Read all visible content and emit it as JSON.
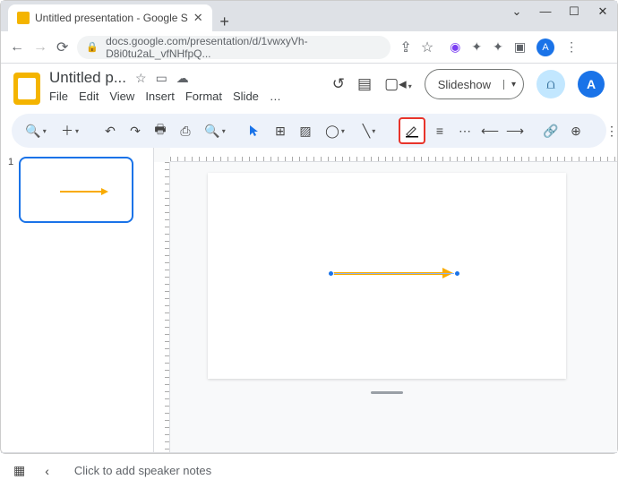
{
  "browser": {
    "tab_title": "Untitled presentation - Google S",
    "url": "docs.google.com/presentation/d/1vwxyVh-D8i0tu2aL_vfNHfpQ...",
    "profile_letter": "A"
  },
  "header": {
    "doc_title": "Untitled p...",
    "menus": [
      "File",
      "Edit",
      "View",
      "Insert",
      "Format",
      "Slide",
      "…"
    ],
    "slideshow_label": "Slideshow",
    "account_letter": "A"
  },
  "toolbar": {
    "tooltip": "Line color"
  },
  "slides": {
    "thumb_number": "1"
  },
  "notes": {
    "placeholder": "Click to add speaker notes"
  },
  "colors": {
    "highlight_border": "#e8342b",
    "arrow_color": "#f9ab00",
    "selection": "#1a73e8"
  }
}
